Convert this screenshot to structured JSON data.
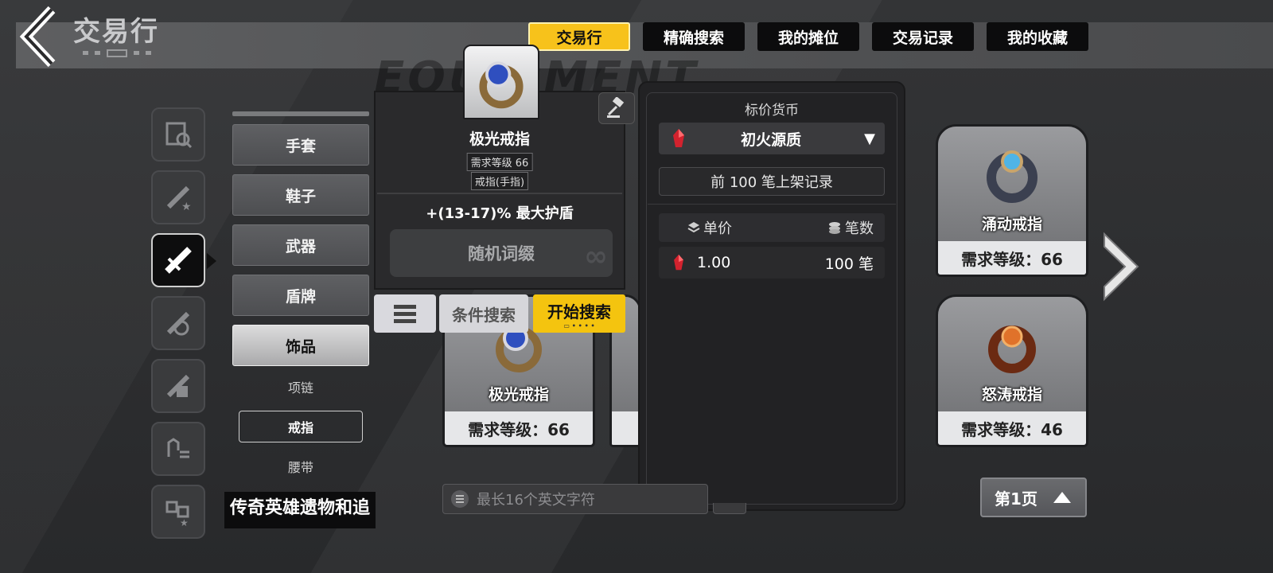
{
  "header": {
    "title": "交易行"
  },
  "tabs": [
    {
      "label": "交易行",
      "active": true
    },
    {
      "label": "精确搜索",
      "active": false
    },
    {
      "label": "我的摊位",
      "active": false
    },
    {
      "label": "交易记录",
      "active": false
    },
    {
      "label": "我的收藏",
      "active": false
    }
  ],
  "watermark": "EQUIPMENT",
  "side_icons": [
    "search-list-icon",
    "sword-star-icon",
    "sword-icon",
    "armor-icon",
    "weapon-icon",
    "hand-list-icon",
    "puzzle-star-icon"
  ],
  "categories": [
    {
      "label": "手套"
    },
    {
      "label": "鞋子"
    },
    {
      "label": "武器"
    },
    {
      "label": "盾牌"
    },
    {
      "label": "饰品",
      "active": true
    }
  ],
  "subcategories": [
    {
      "label": "项链"
    },
    {
      "label": "戒指",
      "active": true
    },
    {
      "label": "腰带"
    }
  ],
  "legend_category": "传奇英雄遗物和追",
  "detail": {
    "name": "极光戒指",
    "level_tag": "需求等级 66",
    "type_tag": "戒指(手指)",
    "affix": "+(13-17)% 最大护盾",
    "random_affix": "随机词缀",
    "cond_search": "条件搜索",
    "start_search": "开始搜索"
  },
  "currency_panel": {
    "title": "标价货币",
    "currency": "初火源质",
    "records_label": "前 100 笔上架记录",
    "col_price": "单价",
    "col_count": "笔数",
    "row_price": "1.00",
    "row_count": "100 笔"
  },
  "items": [
    {
      "name": "涌动戒指",
      "level": "需求等级：66",
      "color": "#3a8fc4"
    },
    {
      "name": "极光戒指",
      "level": "需求等级：66",
      "color": "#3b5fd1"
    },
    {
      "name": "怒涛戒指",
      "level": "需求等级：46",
      "color": "#c4521c"
    }
  ],
  "search": {
    "placeholder": "最长16个英文字符"
  },
  "pager": {
    "label": "第1页"
  }
}
